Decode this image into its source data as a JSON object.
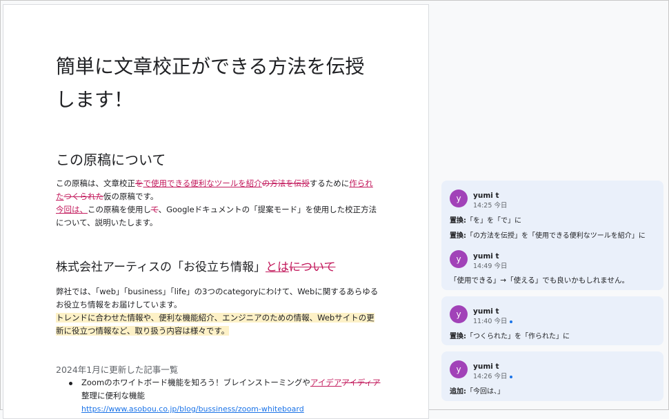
{
  "doc": {
    "title": "簡単に文章校正ができる方法を伝授します！",
    "section1": {
      "heading": "この原稿について",
      "p1_a": "この原稿は、文章校正",
      "p1_del1": "を",
      "p1_ins1": "で使用できる便利なツールを紹介",
      "p1_del2": "の方法を伝授",
      "p1_b": "するために",
      "p1_ins2": "作られた",
      "p1_del3": "つくられた",
      "p1_c": "仮の原稿です。",
      "p2_ins": "今回は、",
      "p2_a": "この原稿を使用し",
      "p2_del": "て",
      "p2_b": "、Googleドキュメントの「提案モード」を使用した校正方法について、説明いたします。"
    },
    "section2": {
      "heading_a": "株式会社アーティスの「お役立ち情報」",
      "heading_ins": "とは",
      "heading_del": "について",
      "p1": "弊社では、「web」「business」「life」の3つのcategoryにわけて、Webに関するあらゆるお役立ち情報をお届けしています。",
      "p2": "トレンドに合わせた情報や、便利な機能紹介、エンジニアのための情報、Webサイトの更新に役立つ情報など、取り扱う内容は様々です。"
    },
    "section3": {
      "heading": "2024年1月に更新した記事一覧",
      "bullet_a": "Zoomのホワイトボード機能を知ろう！ブレインストーミングや",
      "bullet_ins": "アイデア",
      "bullet_del": "アイディア",
      "bullet_b": "整理に便利な機能",
      "link": "https://www.asobou.co.jp/blog/bussiness/zoom-whiteboard"
    }
  },
  "comments": [
    {
      "avatar": "y",
      "name": "yumi t",
      "time": "14:25 今日",
      "lines": [
        {
          "label": "置換:",
          "text": "「を」を「で」に"
        },
        {
          "label": "置換:",
          "text": "「の方法を伝授」を「使用できる便利なツールを紹介」に"
        }
      ],
      "reply": {
        "avatar": "y",
        "name": "yumi t",
        "time": "14:49 今日",
        "text": "「使用できる」→「使える」でも良いかもしれません。"
      }
    },
    {
      "avatar": "y",
      "name": "yumi t",
      "time": "11:40 今日",
      "lines": [
        {
          "label": "置換:",
          "text": "「つくられた」を「作られた」に"
        }
      ]
    },
    {
      "avatar": "y",
      "name": "yumi t",
      "time": "14:26 今日",
      "lines": [
        {
          "label": "追加:",
          "text": "「今回は、」"
        }
      ]
    }
  ],
  "colors": {
    "suggestion": "#c2185b",
    "avatar": "#a142b8",
    "card": "#eaf0fa",
    "highlight": "#fdf1c7"
  }
}
